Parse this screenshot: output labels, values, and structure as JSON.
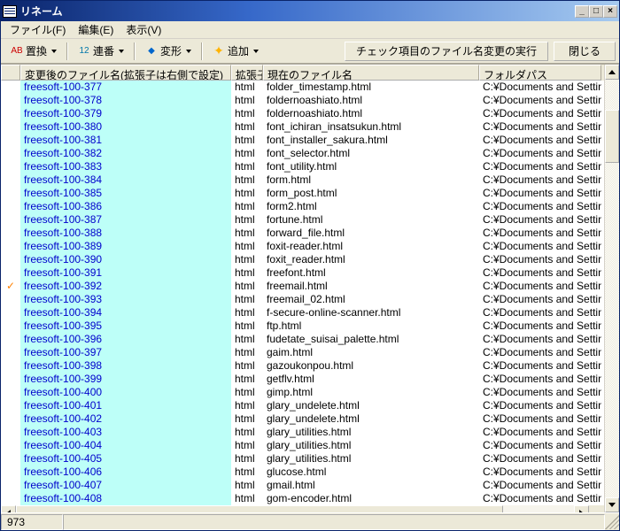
{
  "window": {
    "title": "リネーム"
  },
  "menu": {
    "file": "ファイル(F)",
    "edit": "編集(E)",
    "view": "表示(V)"
  },
  "toolbar": {
    "replace": "置換",
    "seq": "連番",
    "transform": "変形",
    "add": "追加",
    "execute": "チェック項目のファイル名変更の実行",
    "close": "閉じる"
  },
  "columns": {
    "mark": "",
    "newname": "変更後のファイル名(拡張子は右側で設定)",
    "ext": "拡張子",
    "curname": "現在のファイル名",
    "folder": "フォルダパス"
  },
  "status": {
    "count": "973"
  },
  "folderPath": "C:¥Documents and Setting",
  "rows": [
    {
      "mark": "",
      "new": "freesoft-100-377",
      "ext": "html",
      "cur": "folder_timestamp.html"
    },
    {
      "mark": "",
      "new": "freesoft-100-378",
      "ext": "html",
      "cur": "foldernoashiato.html"
    },
    {
      "mark": "",
      "new": "freesoft-100-379",
      "ext": "html",
      "cur": "foldernoashiato.html"
    },
    {
      "mark": "",
      "new": "freesoft-100-380",
      "ext": "html",
      "cur": "font_ichiran_insatsukun.html"
    },
    {
      "mark": "",
      "new": "freesoft-100-381",
      "ext": "html",
      "cur": "font_installer_sakura.html"
    },
    {
      "mark": "",
      "new": "freesoft-100-382",
      "ext": "html",
      "cur": "font_selector.html"
    },
    {
      "mark": "",
      "new": "freesoft-100-383",
      "ext": "html",
      "cur": "font_utility.html"
    },
    {
      "mark": "",
      "new": "freesoft-100-384",
      "ext": "html",
      "cur": "form.html"
    },
    {
      "mark": "",
      "new": "freesoft-100-385",
      "ext": "html",
      "cur": "form_post.html"
    },
    {
      "mark": "",
      "new": "freesoft-100-386",
      "ext": "html",
      "cur": "form2.html"
    },
    {
      "mark": "",
      "new": "freesoft-100-387",
      "ext": "html",
      "cur": "fortune.html"
    },
    {
      "mark": "",
      "new": "freesoft-100-388",
      "ext": "html",
      "cur": "forward_file.html"
    },
    {
      "mark": "",
      "new": "freesoft-100-389",
      "ext": "html",
      "cur": "foxit-reader.html"
    },
    {
      "mark": "",
      "new": "freesoft-100-390",
      "ext": "html",
      "cur": "foxit_reader.html"
    },
    {
      "mark": "",
      "new": "freesoft-100-391",
      "ext": "html",
      "cur": "freefont.html"
    },
    {
      "mark": "✓",
      "new": "freesoft-100-392",
      "ext": "html",
      "cur": "freemail.html"
    },
    {
      "mark": "",
      "new": "freesoft-100-393",
      "ext": "html",
      "cur": "freemail_02.html"
    },
    {
      "mark": "",
      "new": "freesoft-100-394",
      "ext": "html",
      "cur": "f-secure-online-scanner.html"
    },
    {
      "mark": "",
      "new": "freesoft-100-395",
      "ext": "html",
      "cur": "ftp.html"
    },
    {
      "mark": "",
      "new": "freesoft-100-396",
      "ext": "html",
      "cur": "fudetate_suisai_palette.html"
    },
    {
      "mark": "",
      "new": "freesoft-100-397",
      "ext": "html",
      "cur": "gaim.html"
    },
    {
      "mark": "",
      "new": "freesoft-100-398",
      "ext": "html",
      "cur": "gazoukonpou.html"
    },
    {
      "mark": "",
      "new": "freesoft-100-399",
      "ext": "html",
      "cur": "getflv.html"
    },
    {
      "mark": "",
      "new": "freesoft-100-400",
      "ext": "html",
      "cur": "gimp.html"
    },
    {
      "mark": "",
      "new": "freesoft-100-401",
      "ext": "html",
      "cur": "glary_undelete.html"
    },
    {
      "mark": "",
      "new": "freesoft-100-402",
      "ext": "html",
      "cur": "glary_undelete.html"
    },
    {
      "mark": "",
      "new": "freesoft-100-403",
      "ext": "html",
      "cur": "glary_utilities.html"
    },
    {
      "mark": "",
      "new": "freesoft-100-404",
      "ext": "html",
      "cur": "glary_utilities.html"
    },
    {
      "mark": "",
      "new": "freesoft-100-405",
      "ext": "html",
      "cur": "glary_utilities.html"
    },
    {
      "mark": "",
      "new": "freesoft-100-406",
      "ext": "html",
      "cur": "glucose.html"
    },
    {
      "mark": "",
      "new": "freesoft-100-407",
      "ext": "html",
      "cur": "gmail.html"
    },
    {
      "mark": "",
      "new": "freesoft-100-408",
      "ext": "html",
      "cur": "gom-encoder.html"
    }
  ]
}
